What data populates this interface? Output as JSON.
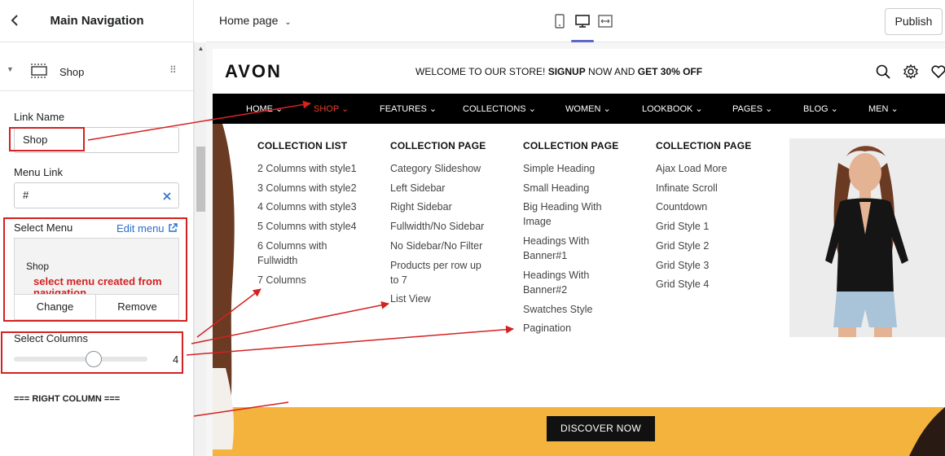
{
  "panel": {
    "title": "Main Navigation",
    "section_label": "Shop",
    "link_name_label": "Link Name",
    "link_name_value": "Shop",
    "menu_link_label": "Menu Link",
    "menu_link_value": "#",
    "select_menu_label": "Select Menu",
    "edit_menu_label": "Edit menu",
    "selected_menu": "Shop",
    "annotation": "select menu created from navigation",
    "change_label": "Change",
    "remove_label": "Remove",
    "select_columns_label": "Select Columns",
    "columns_value": "4",
    "columns_fraction": 0.6,
    "right_column_label": "=== RIGHT COLUMN ==="
  },
  "topbar": {
    "page": "Home page",
    "publish_label": "Publish",
    "active_device": "desktop"
  },
  "store": {
    "logo": "AVON",
    "announcement_pre": "WELCOME TO OUR STORE! ",
    "announcement_b1": "SIGNUP",
    "announcement_mid": " NOW AND ",
    "announcement_b2": "GET 30% OFF",
    "nav": [
      {
        "label": "HOME"
      },
      {
        "label": "SHOP"
      },
      {
        "label": "FEATURES"
      },
      {
        "label": "COLLECTIONS"
      },
      {
        "label": "WOMEN"
      },
      {
        "label": "LOOKBOOK"
      },
      {
        "label": "PAGES"
      },
      {
        "label": "BLOG"
      },
      {
        "label": "MEN"
      }
    ],
    "discover_label": "DISCOVER NOW"
  },
  "mega_menu": {
    "columns": [
      {
        "heading": "COLLECTION LIST",
        "items": [
          "2 Columns with style1",
          "3 Columns with style2",
          "4 Columns with style3",
          "5 Columns with style4",
          "6 Columns with",
          "Fullwidth",
          "7 Columns"
        ]
      },
      {
        "heading": "COLLECTION PAGE",
        "items": [
          "Category Slideshow",
          "Left Sidebar",
          "Right Sidebar",
          "Fullwidth/No Sidebar",
          "No Sidebar/No Filter",
          "Products per row up",
          "to 7",
          "List View"
        ]
      },
      {
        "heading": "COLLECTION PAGE",
        "items": [
          "Simple Heading",
          "Small Heading",
          "Big Heading With",
          "Image",
          "Headings With",
          "Banner#1",
          "Headings With",
          "Banner#2",
          "Swatches Style",
          "Pagination"
        ]
      },
      {
        "heading": "COLLECTION PAGE",
        "items": [
          "Ajax Load More",
          "Infinate Scroll",
          "Countdown",
          "Grid Style 1",
          "Grid Style 2",
          "Grid Style 3",
          "Grid Style 4"
        ]
      }
    ]
  },
  "colors": {
    "annotation_red": "#d42121",
    "active_nav": "#e8412c",
    "hero_yellow": "#f4b33c",
    "link_blue": "#2c6ecb"
  }
}
